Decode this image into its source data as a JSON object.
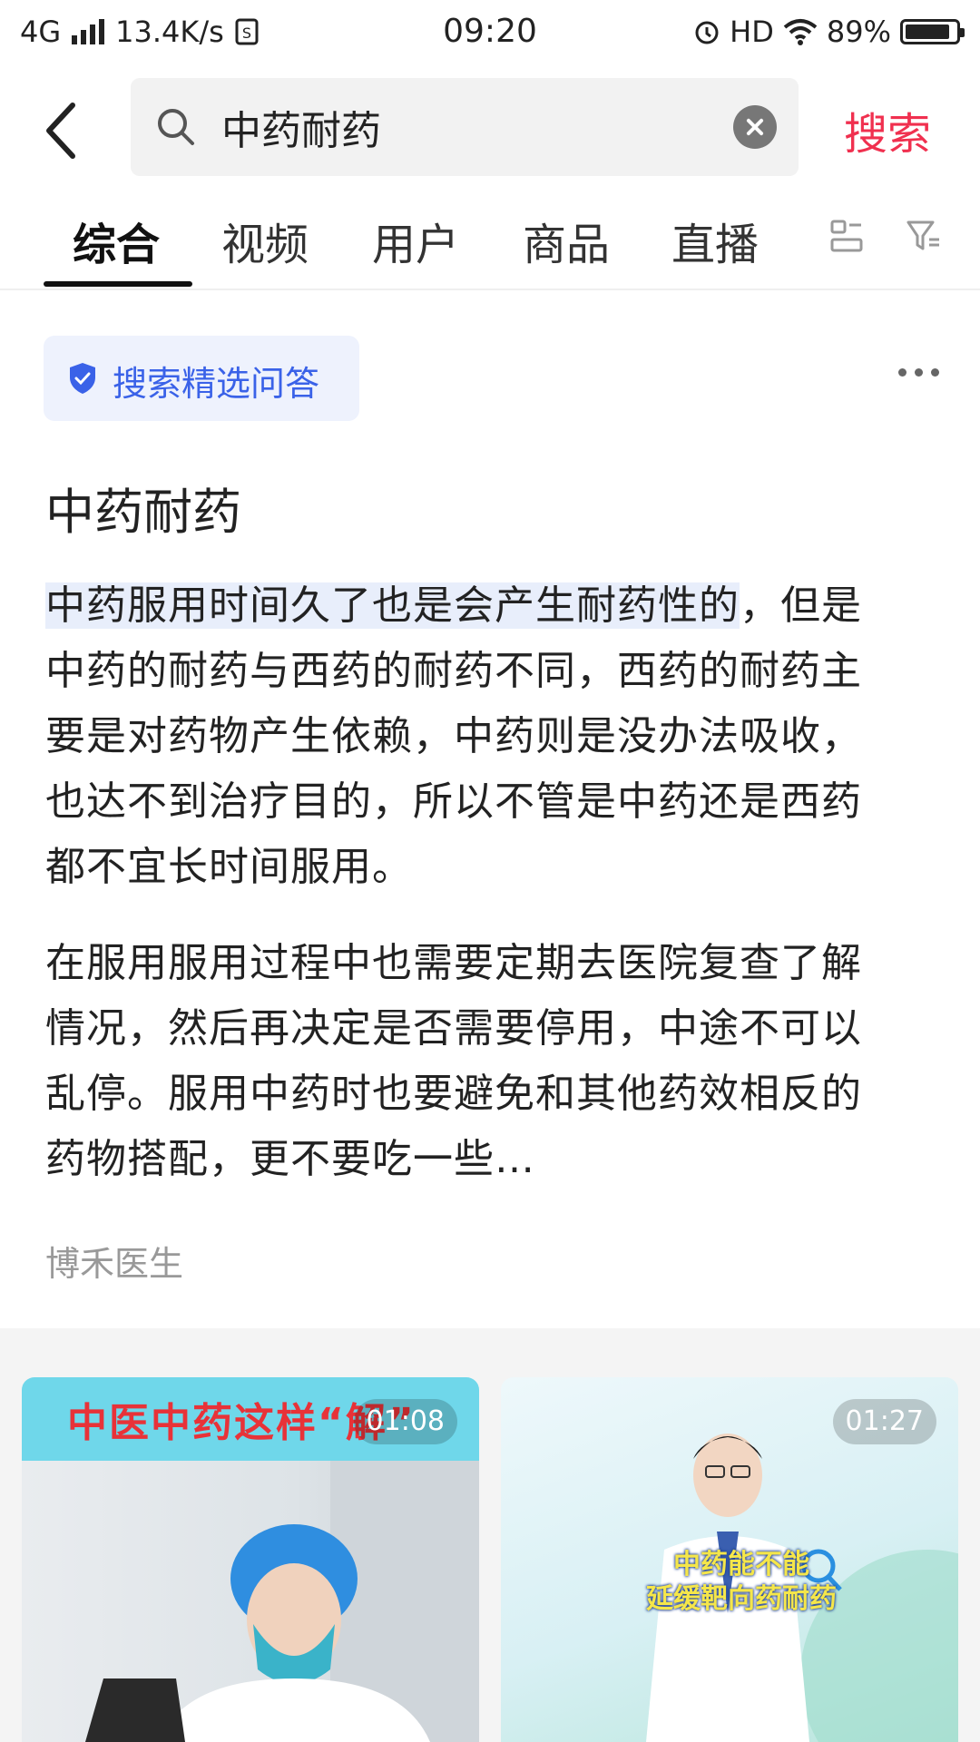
{
  "status_bar": {
    "network": "4G",
    "speed": "13.4K/s",
    "time": "09:20",
    "hd": "HD",
    "battery": "89%",
    "battery_level": 0.89
  },
  "header": {
    "query": "中药耐药",
    "submit_label": "搜索"
  },
  "tabs": [
    {
      "label": "综合",
      "active": true
    },
    {
      "label": "视频",
      "active": false
    },
    {
      "label": "用户",
      "active": false
    },
    {
      "label": "商品",
      "active": false
    },
    {
      "label": "直播",
      "active": false
    }
  ],
  "qa": {
    "badge": "搜索精选问答",
    "title": "中药耐药",
    "para1_highlight": "中药服用时间久了也是会产生耐药性的",
    "para1_rest": "，但是中药的耐药与西药的耐药不同，西药的耐药主要是对药物产生依赖，中药则是没办法吸收，也达不到治疗目的，所以不管是中药还是西药都不宜长时间服用。",
    "para2": "在服用服用过程中也需要定期去医院复查了解情况，然后再决定是否需要停用，中途不可以乱停。服用中药时也要避免和其他药效相反的药物搭配，更不要吃一些…",
    "source": "博禾医生"
  },
  "videos": [
    {
      "duration": "01:08",
      "banner": "中医中药这样“解”"
    },
    {
      "duration": "01:27",
      "title_line1": "中药能不能",
      "title_line2": "延缓靶向药耐药"
    }
  ],
  "colors": {
    "accent_red": "#f0304f",
    "qa_blue": "#3a62e8"
  }
}
